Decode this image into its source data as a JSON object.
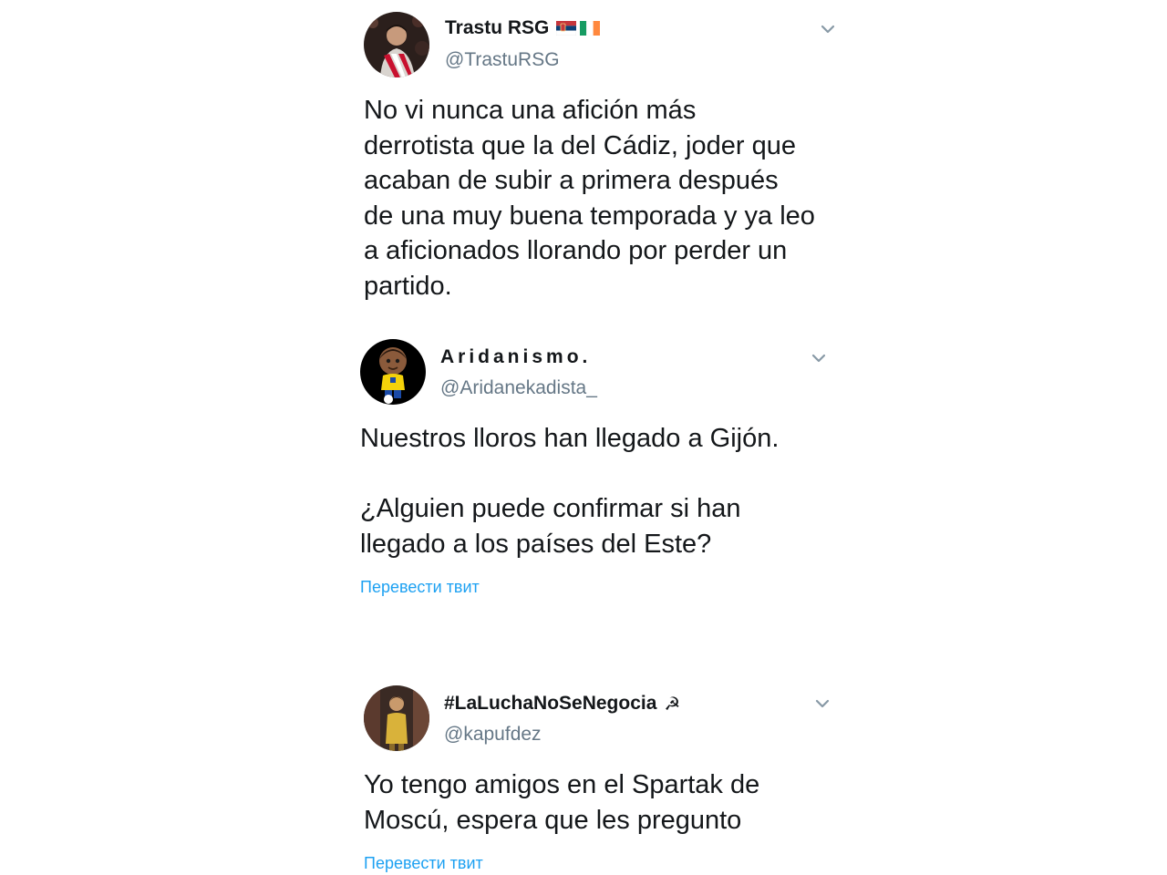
{
  "tweets": [
    {
      "display_name": "Trastu RSG",
      "flag_icons": [
        "serbia-flag-icon",
        "ireland-flag-icon"
      ],
      "handle": "@TrastuRSG",
      "text": "No vi nunca una afición más\nderrotista que la del Cádiz, joder que\nacaban de subir a primera después\nde una muy buena temporada y ya leo\na aficionados llorando por perder un\npartido."
    },
    {
      "display_name": "Aridanismo.",
      "handle": "@Aridanekadista_",
      "text": "Nuestros lloros han llegado a Gijón.\n\n¿Alguien puede confirmar si han\nllegado a los países del Este?",
      "translate_label": "Перевести твит"
    },
    {
      "display_name": "#LaLuchaNoSeNegocia",
      "name_icon": "hammer-and-sickle-icon",
      "name_glyph": "☭",
      "handle": "@kapufdez",
      "text": "Yo tengo amigos en el Spartak de\nMoscú, espera que les pregunto",
      "translate_label": "Перевести твит"
    }
  ],
  "colors": {
    "text": "#14171a",
    "secondary": "#657786",
    "link": "#1da1f2",
    "chevron": "#8899a6"
  }
}
